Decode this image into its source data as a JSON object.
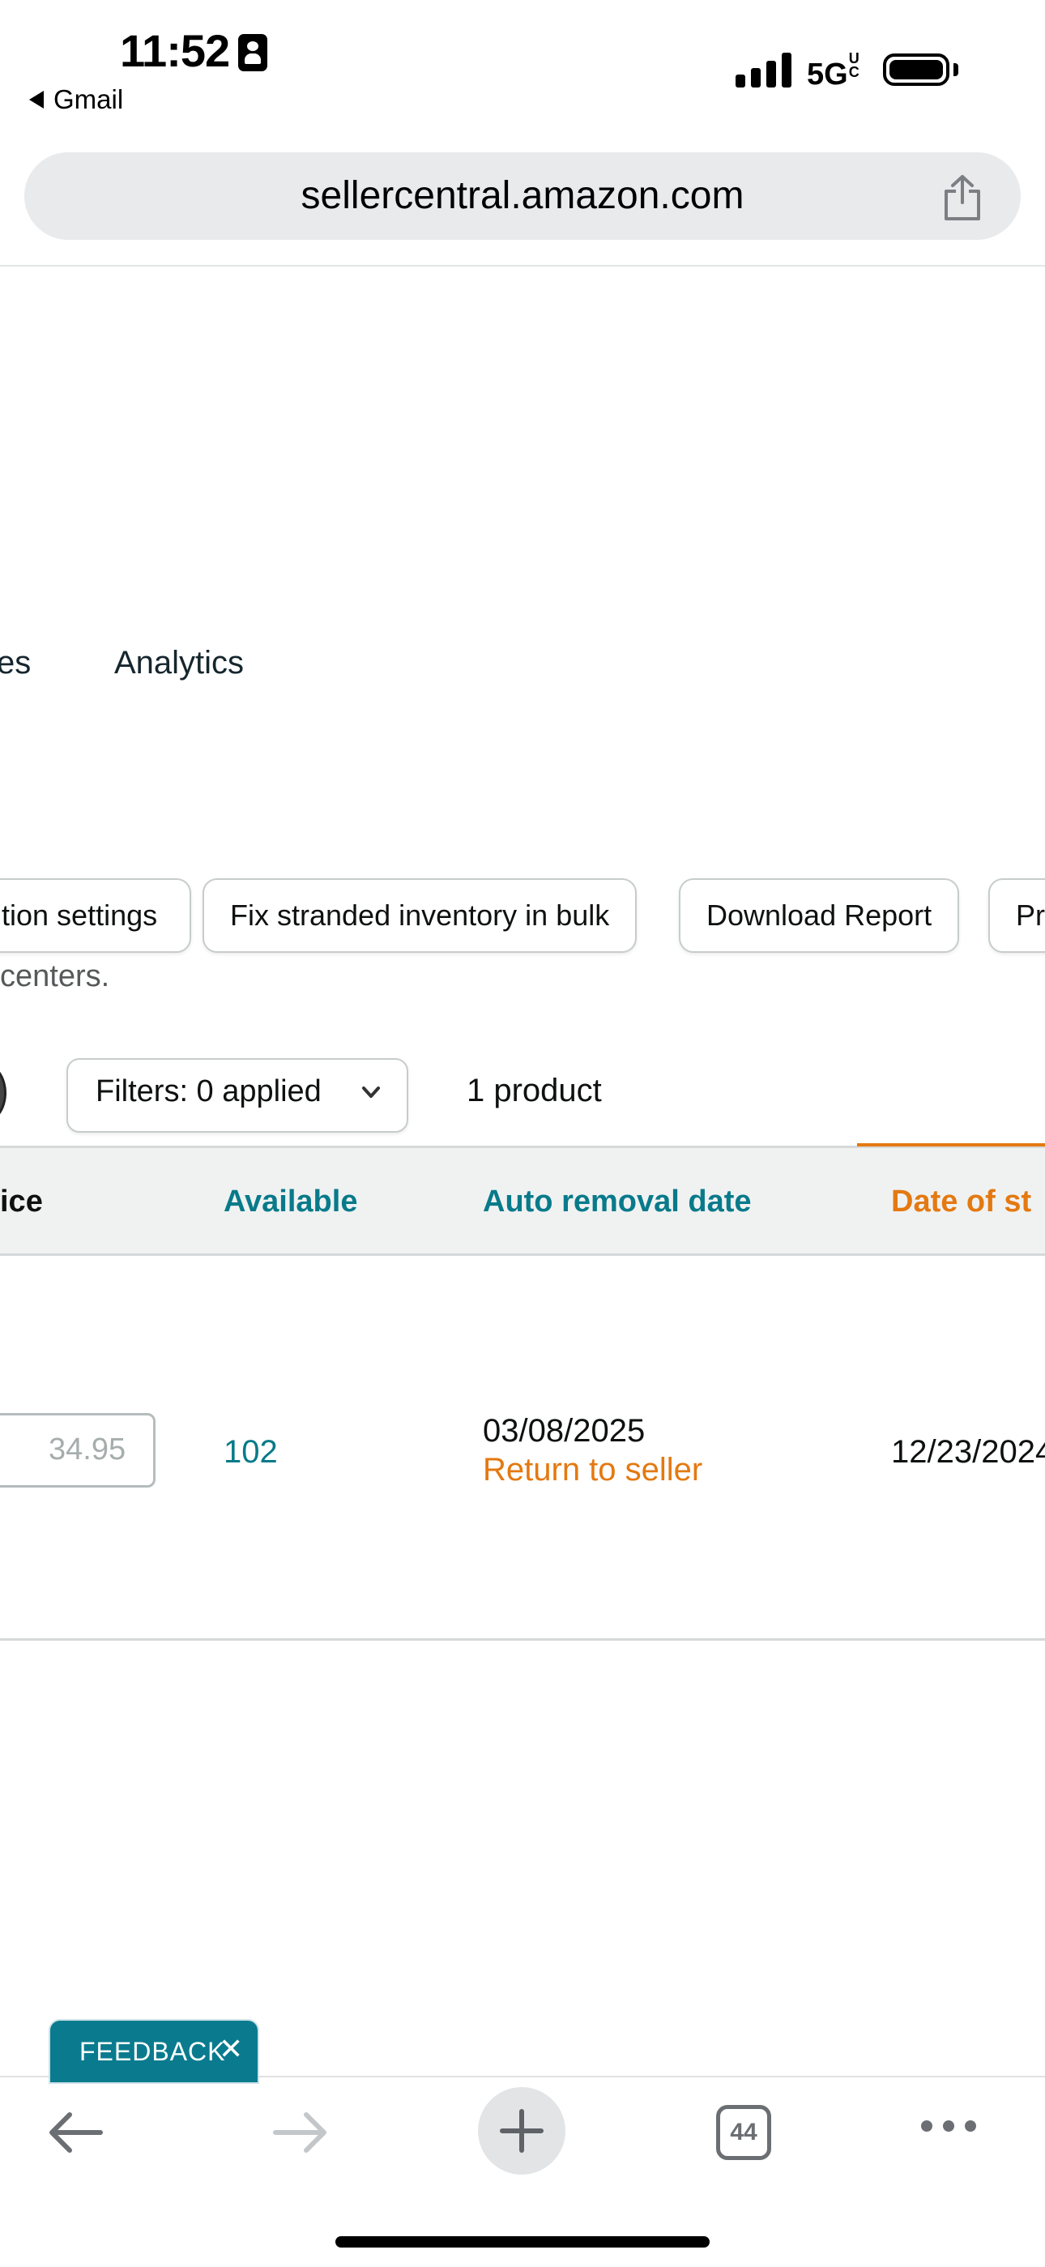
{
  "status_bar": {
    "time": "11:52",
    "back_app": "Gmail",
    "network": "5GUC",
    "network_main": "5G",
    "network_sup": "U",
    "network_sub": "C"
  },
  "browser": {
    "url": "sellercentral.amazon.com",
    "tab_count": "44"
  },
  "nav": {
    "partial_tab": "es",
    "analytics": "Analytics"
  },
  "actions": {
    "settings_partial": "tion settings",
    "fix_stranded": "Fix stranded inventory in bulk",
    "download_report": "Download Report",
    "partial_next": "Pr"
  },
  "description_partial": "centers.",
  "filters": {
    "label": "Filters: 0 applied",
    "product_count": "1 product"
  },
  "table": {
    "headers": {
      "price_partial": "ice",
      "available": "Available",
      "auto_removal": "Auto removal date",
      "date_of_stranding_partial": "Date of st"
    },
    "row": {
      "price": "34.95",
      "available": "102",
      "auto_removal_date": "03/08/2025",
      "removal_action": "Return to seller",
      "date_of_stranding_partial": "12/23/2024"
    }
  },
  "feedback": {
    "label": "FEEDBACK",
    "close": "✕"
  },
  "colors": {
    "teal": "#087a8a",
    "orange": "#e47911",
    "feedback_bg": "#0a7b8e"
  }
}
